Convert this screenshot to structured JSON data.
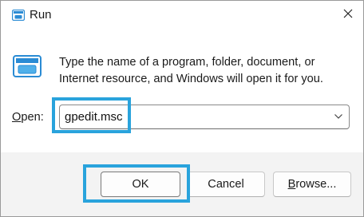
{
  "window": {
    "title": "Run",
    "icon": "run-icon",
    "close_icon": "close-icon"
  },
  "dialog": {
    "icon": "run-app-icon",
    "description": "Type the name of a program, folder, document, or Internet resource, and Windows will open it for you."
  },
  "open_field": {
    "label_accel": "O",
    "label_rest": "pen:",
    "value": "gpedit.msc",
    "dropdown_icon": "chevron-down-icon"
  },
  "buttons": {
    "ok": "OK",
    "cancel": "Cancel",
    "browse_accel": "B",
    "browse_rest": "rowse..."
  },
  "colors": {
    "highlight": "#29a3dc",
    "icon_blue": "#2a8bd4",
    "footer_bg": "#f3f3f3"
  }
}
